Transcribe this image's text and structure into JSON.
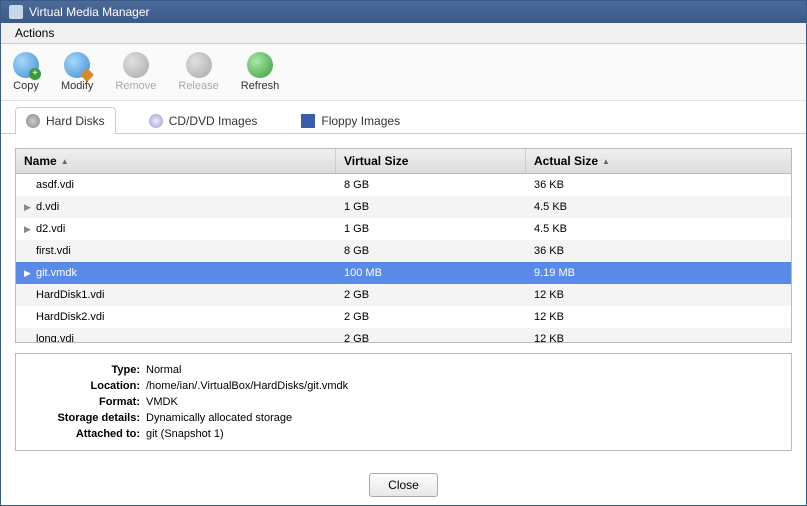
{
  "window": {
    "title": "Virtual Media Manager"
  },
  "menubar": {
    "actions": "Actions"
  },
  "toolbar": {
    "copy": "Copy",
    "modify": "Modify",
    "remove": "Remove",
    "release": "Release",
    "refresh": "Refresh"
  },
  "tabs": {
    "hard_disks": "Hard Disks",
    "cd_dvd": "CD/DVD Images",
    "floppy": "Floppy Images"
  },
  "table": {
    "headers": {
      "name": "Name",
      "vsize": "Virtual Size",
      "asize": "Actual Size"
    },
    "rows": [
      {
        "name": "asdf.vdi",
        "vsize": "8 GB",
        "asize": "36 KB",
        "expandable": false
      },
      {
        "name": "d.vdi",
        "vsize": "1 GB",
        "asize": "4.5 KB",
        "expandable": true
      },
      {
        "name": "d2.vdi",
        "vsize": "1 GB",
        "asize": "4.5 KB",
        "expandable": true
      },
      {
        "name": "first.vdi",
        "vsize": "8 GB",
        "asize": "36 KB",
        "expandable": false
      },
      {
        "name": "git.vmdk",
        "vsize": "100 MB",
        "asize": "9.19 MB",
        "expandable": true,
        "selected": true
      },
      {
        "name": "HardDisk1.vdi",
        "vsize": "2 GB",
        "asize": "12 KB",
        "expandable": false
      },
      {
        "name": "HardDisk2.vdi",
        "vsize": "2 GB",
        "asize": "12 KB",
        "expandable": false
      },
      {
        "name": "long.vdi",
        "vsize": "2 GB",
        "asize": "12 KB",
        "expandable": false
      }
    ]
  },
  "details": {
    "labels": {
      "type": "Type:",
      "location": "Location:",
      "format": "Format:",
      "storage": "Storage details:",
      "attached": "Attached to:"
    },
    "type": "Normal",
    "location": "/home/ian/.VirtualBox/HardDisks/git.vmdk",
    "format": "VMDK",
    "storage": "Dynamically allocated storage",
    "attached": "git (Snapshot 1)"
  },
  "footer": {
    "close": "Close"
  }
}
